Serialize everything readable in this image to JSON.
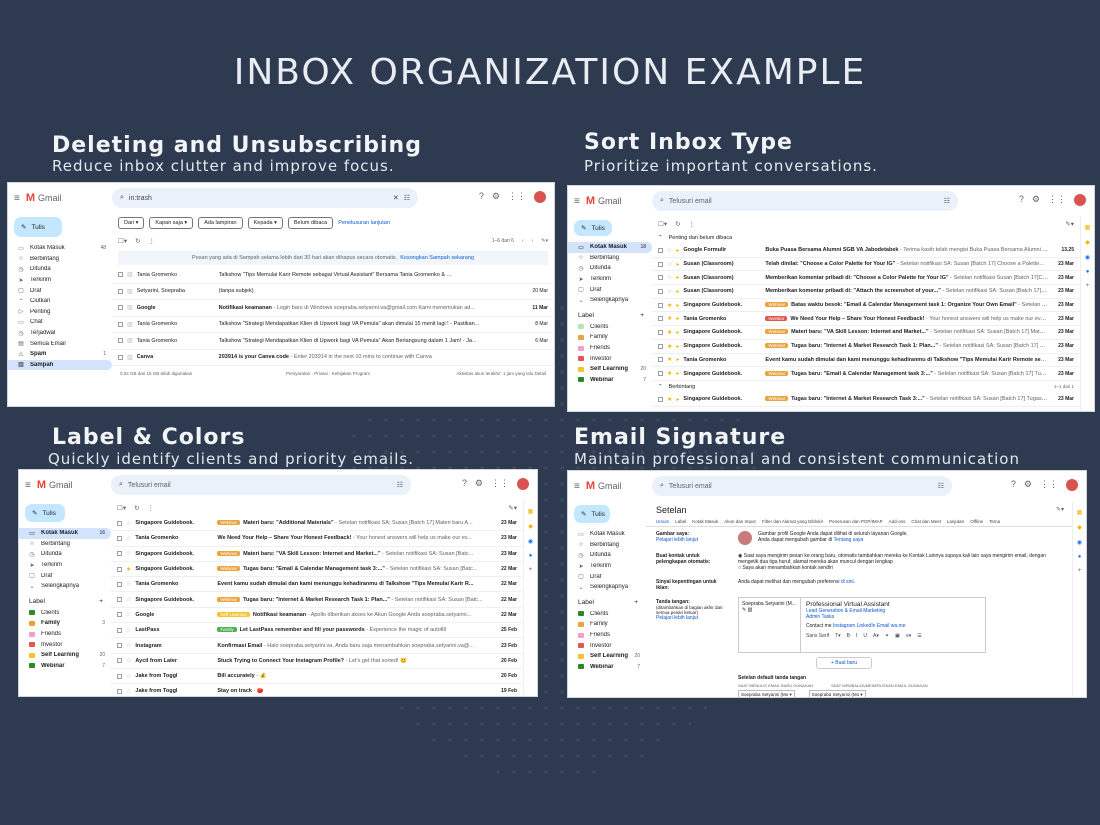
{
  "main_title": "INBOX ORGANIZATION EXAMPLE",
  "sections": {
    "delete": {
      "title": "Deleting and Unsubscribing",
      "subtitle": "Reduce inbox clutter and improve focus."
    },
    "sort": {
      "title": "Sort Inbox Type",
      "subtitle": "Prioritize important conversations."
    },
    "label": {
      "title": "Label & Colors",
      "subtitle": "Quickly identify clients and priority emails."
    },
    "signature": {
      "title": "Email Signature",
      "subtitle": "Maintain professional and consistent communication"
    }
  },
  "gmail": {
    "logo": "Gmail",
    "compose": "Tulis",
    "search_placeholder": "Telusuri email"
  },
  "colors": {
    "bg": "#2d3a4f",
    "compose": "#c2e7ff",
    "active": "#d3e3fd",
    "link": "#0b57d0"
  },
  "panel1": {
    "search_value": "in:trash",
    "nav": [
      {
        "icon": "inbox-icon",
        "glyph": "▭",
        "label": "Kotak Masuk",
        "count": "48"
      },
      {
        "icon": "star-icon",
        "glyph": "☆",
        "label": "Berbintang",
        "count": ""
      },
      {
        "icon": "clock-icon",
        "glyph": "◷",
        "label": "Ditunda",
        "count": ""
      },
      {
        "icon": "send-icon",
        "glyph": "➤",
        "label": "Terkirim",
        "count": ""
      },
      {
        "icon": "draft-icon",
        "glyph": "▢",
        "label": "Draf",
        "count": ""
      },
      {
        "icon": "chevron-up-icon",
        "glyph": "⌃",
        "label": "Ciutkan",
        "count": ""
      },
      {
        "icon": "important-icon",
        "glyph": "▷",
        "label": "Penting",
        "count": ""
      },
      {
        "icon": "chat-icon",
        "glyph": "▭",
        "label": "Chat",
        "count": ""
      },
      {
        "icon": "scheduled-icon",
        "glyph": "◷",
        "label": "Terjadwal",
        "count": ""
      },
      {
        "icon": "all-mail-icon",
        "glyph": "▤",
        "label": "Semua Email",
        "count": ""
      },
      {
        "icon": "spam-icon",
        "glyph": "⚠",
        "label": "Spam",
        "count": "1"
      },
      {
        "icon": "trash-icon",
        "glyph": "▥",
        "label": "Sampah",
        "count": ""
      }
    ],
    "filters": [
      "Dari ▾",
      "Kapan saja ▾",
      "Ada lampiran",
      "Kepada ▾",
      "Belum dibaca"
    ],
    "advanced": "Penelusuran lanjutan",
    "pagination": "1–6 dari 6",
    "info_text": "Pesan yang ada di Sampah selama lebih dari 30 hari akan dihapus secara otomatis.",
    "info_link": "Kosongkan Sampah sekarang",
    "rows": [
      {
        "sender": "Tania Gromenko",
        "subject": "Talkshow \"Tips Memulai Karir Remote sebagai Virtual Assistant\" Bersama Tania Gromenko & ...",
        "preview": "",
        "date": "",
        "unread": false
      },
      {
        "sender": "Setyarini, Soepraba",
        "subject": "(tanpa subjek)",
        "preview": "",
        "date": "20 Mar",
        "unread": false
      },
      {
        "sender": "Google",
        "subject": "Notifikasi keamanan",
        "preview": " - Login baru di Windows soepraba.setyarini.va@gmail.com Kami menemukan ad...",
        "date": "11 Mar",
        "unread": true
      },
      {
        "sender": "Tania Gromenko",
        "subject": "Talkshow \"Strategi Mendapatkan Klien di Upwork bagi VA Pemula\" akan dimulai 15 menit lagi ! - Pastikan...",
        "preview": "",
        "date": "8 Mar",
        "unread": false
      },
      {
        "sender": "Tania Gromenko",
        "subject": "Talkshow \"Strategi Mendapatkan Klien di Upwork bagi VA Pemula\" Akan Berlangsung dalam 1 Jam! - Ja...",
        "preview": "",
        "date": "6 Mar",
        "unread": false
      },
      {
        "sender": "Canva",
        "subject": "203914 is your Canva code",
        "preview": " - Enter 203914 in the next 10 mins to continue with Canva",
        "date": "",
        "unread": true
      }
    ],
    "storage": "0,02 GB dari 15 GB telah digunakan",
    "footer_mid": "Persyaratan · Privasi · Kebijakan Program",
    "footer_right": "Aktivitas akun terakhir: 1 jam yang lalu Detail"
  },
  "panel2": {
    "nav": [
      {
        "icon": "inbox-icon",
        "glyph": "▭",
        "label": "Kotak Masuk",
        "count": "18"
      },
      {
        "icon": "star-icon",
        "glyph": "☆",
        "label": "Berbintang",
        "count": ""
      },
      {
        "icon": "clock-icon",
        "glyph": "◷",
        "label": "Ditunda",
        "count": ""
      },
      {
        "icon": "send-icon",
        "glyph": "➤",
        "label": "Terkirim",
        "count": ""
      },
      {
        "icon": "draft-icon",
        "glyph": "▢",
        "label": "Draf",
        "count": ""
      },
      {
        "icon": "chevron-down-icon",
        "glyph": "⌄",
        "label": "Selengkapnya",
        "count": ""
      }
    ],
    "label_head": "Label",
    "labels": [
      {
        "name": "Clients",
        "color": "#b5e6b5",
        "count": ""
      },
      {
        "name": "Family",
        "color": "#e8a33d",
        "count": ""
      },
      {
        "name": "Friends",
        "color": "#f2a0c8",
        "count": ""
      },
      {
        "name": "Investor",
        "color": "#e05555",
        "count": ""
      },
      {
        "name": "Self Learning",
        "color": "#f4c430",
        "count": "20"
      },
      {
        "name": "Webinar",
        "color": "#2a8a2a",
        "count": "7"
      }
    ],
    "section1": "Penting dan belum dibaca",
    "section2": "Berbintang",
    "rows": [
      {
        "sender": "Google Formulir",
        "tag": "",
        "tag_color": "",
        "subject": "Buka Puasa Bersama Alumni SGB VA Jabodetabek",
        "preview": " - Terima kasih telah mengisi Buka Puasa Bersama Alumni SGB VA Jab...",
        "date": "13.25",
        "star": false
      },
      {
        "sender": "Susan (Classroom)",
        "tag": "",
        "tag_color": "",
        "subject": "Telah dinilai: \"Choose a Color Palette for Your IG\"",
        "preview": " - Setelan notifikasi SA: Susan [Batch 17] Choose a Palette...",
        "date": "23 Mar",
        "star": false
      },
      {
        "sender": "Susan (Classroom)",
        "tag": "",
        "tag_color": "",
        "subject": "Memberikan komentar pribadi di: \"Choose a Color Palette for Your IG\"",
        "preview": " - Setelan notifikasi Susan [Batch 17]Choose a...",
        "date": "23 Mar",
        "star": false
      },
      {
        "sender": "Susan (Classroom)",
        "tag": "",
        "tag_color": "",
        "subject": "Memberikan komentar pribadi di: \"Attach the screenshot of your...\"",
        "preview": " - Setelan notifikasi SA: Susan [Batch 17] the s...",
        "date": "23 Mar",
        "star": false
      },
      {
        "sender": "Singapore Guidebook.",
        "tag": "Webinar",
        "tag_color": "#e8a33d",
        "subject": "Batas waktu besok: \"Email & Calendar Management task 1: Organize Your Own Email\"",
        "preview": " - Setelan notifikasi...",
        "date": "23 Mar",
        "star": true
      },
      {
        "sender": "Tania Gromenko",
        "tag": "Investor",
        "tag_color": "#e05555",
        "subject": "We Need Your Help – Share Your Honest Feedback!",
        "preview": " - Your honest answers will help us make our events better!",
        "date": "23 Mar",
        "star": true
      },
      {
        "sender": "Singapore Guidebook.",
        "tag": "Webinar",
        "tag_color": "#e8a33d",
        "subject": "Materi baru: \"VA Skill Lesson: Internet and Market...\"",
        "preview": " - Setelan notifikasi SA: Susan [Batch 17] Materi baru VA Sk...",
        "date": "23 Mar",
        "star": true
      },
      {
        "sender": "Singapore Guidebook.",
        "tag": "Webinar",
        "tag_color": "#e8a33d",
        "subject": "Tugas baru: \"Internet & Market Research Task 1: Plan...\"",
        "preview": " - Setelan notifikasi SA: Susan [Batch 17] Tugas baru: Inter...",
        "date": "23 Mar",
        "star": true
      },
      {
        "sender": "Tania Gromenko",
        "tag": "",
        "tag_color": "",
        "subject": "Event kamu sudah dimulai dan kami menunggu kehadiranmu di Talkshow \"Tips Memulai Karir Remote sebagai Virtua...",
        "preview": "",
        "date": "23 Mar",
        "star": true
      },
      {
        "sender": "Singapore Guidebook.",
        "tag": "Webinar",
        "tag_color": "#e8a33d",
        "subject": "Tugas baru: \"Email & Calendar Management task 3:...\"",
        "preview": " - Setelan notifikasi SA: Susan [Batch 17] Tugas baru: Ema...",
        "date": "23 Mar",
        "star": true
      }
    ],
    "starred_rows": [
      {
        "sender": "Singapore Guidebook.",
        "tag": "Webinar",
        "tag_color": "#e8a33d",
        "subject": "Tugas baru: \"Internet & Market Research Task 3:...\"",
        "preview": " - Setelan notifikasi SA: Susan [Batch 17] Tugas baru: Internet...",
        "date": "23 Mar",
        "star": true
      }
    ],
    "starred_pager": "1–1 dari 1"
  },
  "panel3": {
    "nav": [
      {
        "icon": "inbox-icon",
        "glyph": "▭",
        "label": "Kotak Masuk",
        "count": "16"
      },
      {
        "icon": "star-icon",
        "glyph": "☆",
        "label": "Berbintang",
        "count": ""
      },
      {
        "icon": "clock-icon",
        "glyph": "◷",
        "label": "Ditunda",
        "count": ""
      },
      {
        "icon": "send-icon",
        "glyph": "➤",
        "label": "Terkirim",
        "count": ""
      },
      {
        "icon": "draft-icon",
        "glyph": "▢",
        "label": "Draf",
        "count": ""
      },
      {
        "icon": "chevron-down-icon",
        "glyph": "⌄",
        "label": "Selengkapnya",
        "count": ""
      }
    ],
    "label_head": "Label",
    "labels": [
      {
        "name": "Clients",
        "color": "#2a8a2a",
        "count": ""
      },
      {
        "name": "Family",
        "color": "#e8a33d",
        "count": "3"
      },
      {
        "name": "Friends",
        "color": "#f2a0c8",
        "count": ""
      },
      {
        "name": "Investor",
        "color": "#e05555",
        "count": ""
      },
      {
        "name": "Self Learning",
        "color": "#f4c430",
        "count": "20"
      },
      {
        "name": "Webinar",
        "color": "#2a8a2a",
        "count": "7"
      }
    ],
    "rows": [
      {
        "sender": "Singapore Guidebook.",
        "tag": "Webinar",
        "tag_color": "#e8a33d",
        "subject": "Materi baru: \"Additional Materials\"",
        "preview": " - Setelan notifikasi SA: Susan [Batch 17] Materi baru A...",
        "date": "23 Mar",
        "star": false
      },
      {
        "sender": "Tania Gromenko",
        "tag": "",
        "tag_color": "",
        "subject": "We Need Your Help – Share Your Honest Feedback!",
        "preview": " - Your honest answers will help us make our ev...",
        "date": "23 Mar",
        "star": false
      },
      {
        "sender": "Singapore Guidebook.",
        "tag": "Webinar",
        "tag_color": "#e8a33d",
        "subject": "Materi baru: \"VA Skill Lesson: Internet and Market...\"",
        "preview": " - Setelan notifikasi SA: Susan [Batc...",
        "date": "23 Mar",
        "star": false
      },
      {
        "sender": "Singapore Guidebook.",
        "tag": "Webinar",
        "tag_color": "#e8a33d",
        "subject": "Tugas baru: \"Email & Calendar Management task 3:...\"",
        "preview": " - Setelan notifikasi SA: Susan [Batc...",
        "date": "22 Mar",
        "star": true
      },
      {
        "sender": "Tania Gromenko",
        "tag": "",
        "tag_color": "",
        "subject": "Event kamu sudah dimulai dan kami menunggu kehadiranmu di Talkshow \"Tips Memulai Karir R...",
        "preview": "",
        "date": "22 Mar",
        "star": false
      },
      {
        "sender": "Singapore Guidebook.",
        "tag": "Webinar",
        "tag_color": "#e8a33d",
        "subject": "Tugas baru: \"Internet & Market Research Task 1: Plan...\"",
        "preview": " - Setelan notifikasi SA: Susan [Batc...",
        "date": "22 Mar",
        "star": false
      },
      {
        "sender": "Google",
        "tag": "Self Learning",
        "tag_color": "#f4c430",
        "subject": "Notifikasi keamanan",
        "preview": " - Apollo diberikan akses ke Akun Google Anda soepraba.setyarini...",
        "date": "22 Mar",
        "star": false
      },
      {
        "sender": "LastPass",
        "tag": "Family",
        "tag_color": "#4caf50",
        "subject": "Let LastPass remember and fill your passwords",
        "preview": " - Experience the magic of autofill",
        "date": "25 Feb",
        "star": false
      },
      {
        "sender": "Instagram",
        "tag": "",
        "tag_color": "",
        "subject": "Konfirmasi Email",
        "preview": " - Halo soepraba.setyarini.va, Anda baru saja menambahkan soepraba.setyarini.va@...",
        "date": "23 Feb",
        "star": false
      },
      {
        "sender": "Aycil from Later",
        "tag": "",
        "tag_color": "",
        "subject": "Stuck Trying to Connect Your Instagram Profile?",
        "preview": " - Let's get that sorted! 😊",
        "date": "20 Feb",
        "star": false
      },
      {
        "sender": "Jake from Toggl",
        "tag": "",
        "tag_color": "",
        "subject": "Bill accurately",
        "preview": " - 💰",
        "date": "20 Feb",
        "star": false
      },
      {
        "sender": "Jake from Toggl",
        "tag": "",
        "tag_color": "",
        "subject": "Stay on track",
        "preview": " - 🍅",
        "date": "19 Feb",
        "star": false
      }
    ]
  },
  "panel4": {
    "nav": [
      {
        "icon": "inbox-icon",
        "glyph": "▭",
        "label": "Kotak Masuk",
        "count": ""
      },
      {
        "icon": "star-icon",
        "glyph": "☆",
        "label": "Berbintang",
        "count": ""
      },
      {
        "icon": "clock-icon",
        "glyph": "◷",
        "label": "Ditunda",
        "count": ""
      },
      {
        "icon": "send-icon",
        "glyph": "➤",
        "label": "Terkirim",
        "count": ""
      },
      {
        "icon": "draft-icon",
        "glyph": "▢",
        "label": "Draf",
        "count": ""
      },
      {
        "icon": "chevron-down-icon",
        "glyph": "⌄",
        "label": "Selengkapnya",
        "count": ""
      }
    ],
    "label_head": "Label",
    "labels": [
      {
        "name": "Clients",
        "color": "#2a8a2a",
        "count": ""
      },
      {
        "name": "Family",
        "color": "#e8a33d",
        "count": ""
      },
      {
        "name": "Friends",
        "color": "#f2a0c8",
        "count": ""
      },
      {
        "name": "Investor",
        "color": "#e05555",
        "count": ""
      },
      {
        "name": "Self Learning",
        "color": "#f4c430",
        "count": "20"
      },
      {
        "name": "Webinar",
        "color": "#2a8a2a",
        "count": "7"
      }
    ],
    "settings_title": "Setelan",
    "tabs": [
      "Umum",
      "Label",
      "Kotak Masuk",
      "Akun dan Impor",
      "Filter dan Alamat yang Diblokir",
      "Penerusan dan POP/IMAP",
      "Add-ons",
      "Chat dan Meet",
      "Lanjutan",
      "Offline",
      "Tema"
    ],
    "picture_key": "Gambar saya:",
    "picture_link": "Pelajari lebih lanjut",
    "picture_text": "Gambar profil Google Anda dapat dilihat di seluruh layanan Google.",
    "picture_text2": "Anda dapat mengubah gambar di",
    "picture_text2_link": "Tentang saya",
    "contacts_key": "Buat kontak untuk pelengkapan otomatis:",
    "contacts_opt1": "Saat saya mengirim pesan ke orang baru, otomatis tambahkan mereka ke Kontak Lainnya supaya kali lain saya mengirim email, dengan mengetik dua tiga huruf, alamat mereka akan muncul dengan lengkap",
    "contacts_opt2": "Saya akan menambahkan kontak sendiri",
    "ads_key": "Sinyal kepentingan untuk iklan:",
    "ads_text": "Anda dapat melihat dan mengubah preferensi",
    "ads_link": "di sini.",
    "sig_key": "Tanda tangan:",
    "sig_hint": "(ditambahkan di bagian akhir dari semua pesan keluar)",
    "sig_link": "Pelajari lebih lanjut",
    "sig_name": "Soepraba Setyarini (M...",
    "sig_title": "Professional Virtual Assistant",
    "sig_line1": "Lead Generation & Email Marketing",
    "sig_line2": "Admin Tasks",
    "sig_contact": "Contact me",
    "sig_links": "Instagram  LinkedIn  Email  wa.me",
    "font_name": "Sans Serif",
    "new_btn": "+ Buat baru",
    "default_title": "Setelan default tanda tangan",
    "default_new_label": "SAAT MENULIS EMAIL BARU GUNAKAN",
    "default_reply_label": "SAAT MEMBALAS/MENERUSKAN EMAIL GUNAKAN",
    "default_new": "Soepraba Setyarini (Mo ▾",
    "default_reply": "Soepraba Setyarini (Mo ▾"
  }
}
